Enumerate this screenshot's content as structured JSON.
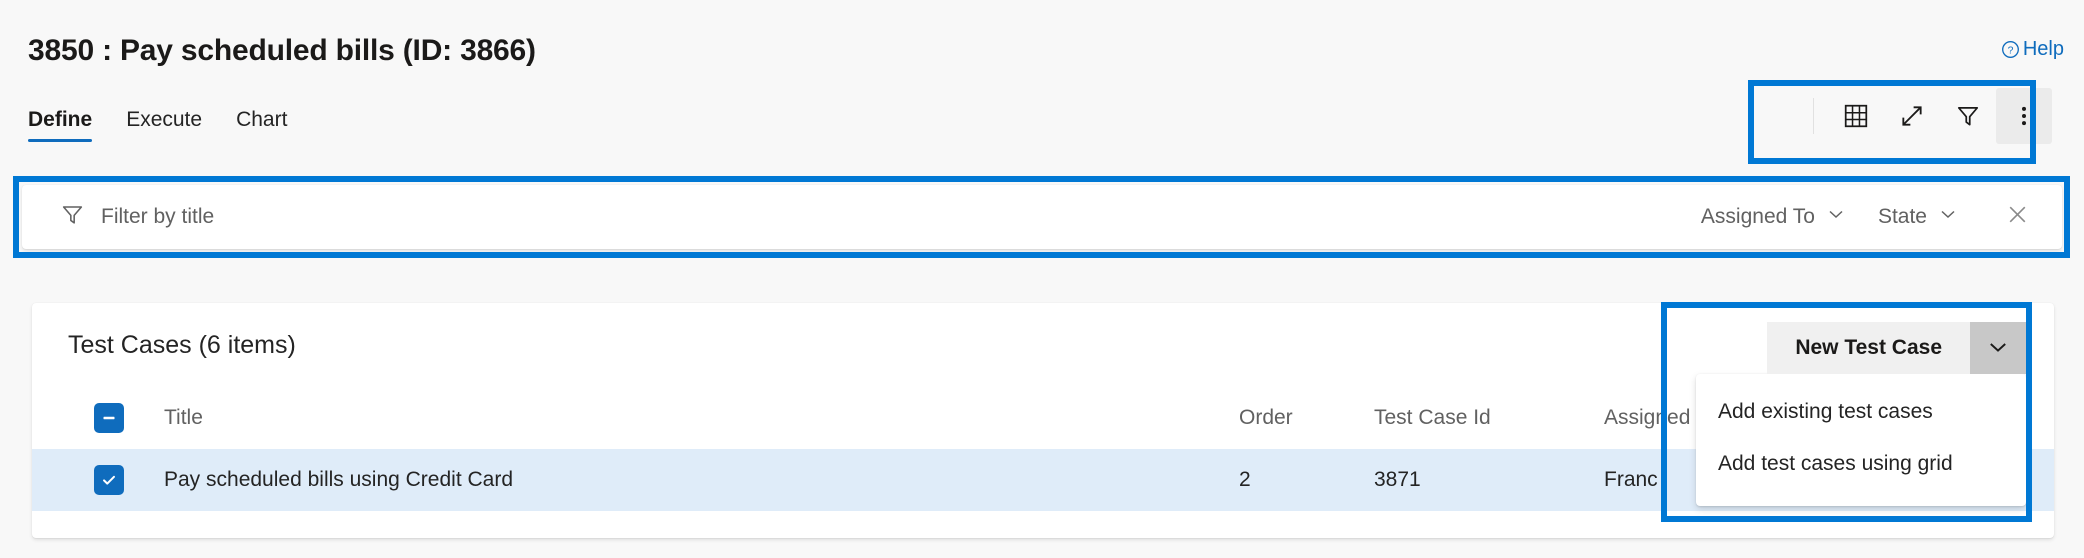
{
  "header": {
    "title": "3850 : Pay scheduled bills (ID: 3866)",
    "help_label": "Help",
    "help_icon": "question-circle-icon"
  },
  "tabs": [
    {
      "label": "Define",
      "active": true
    },
    {
      "label": "Execute",
      "active": false
    },
    {
      "label": "Chart",
      "active": false
    }
  ],
  "toolbar": {
    "buttons": [
      {
        "name": "grid-view-icon",
        "title": "Grid view"
      },
      {
        "name": "expand-icon",
        "title": "Enter full screen"
      },
      {
        "name": "filter-icon",
        "title": "Filter"
      },
      {
        "name": "more-options-icon",
        "title": "More options"
      }
    ]
  },
  "filter_bar": {
    "icon": "filter-funnel-icon",
    "placeholder": "Filter by title",
    "value": "",
    "assigned_to_label": "Assigned To",
    "state_label": "State",
    "close_icon": "close-icon"
  },
  "content": {
    "card_title": "Test Cases (6 items)",
    "new_test_case_label": "New Test Case",
    "dropdown_items": [
      "Add existing test cases",
      "Add test cases using grid"
    ],
    "columns": {
      "title": "Title",
      "order": "Order",
      "test_case_id": "Test Case Id",
      "assigned_to": "Assigned"
    },
    "rows": [
      {
        "selected": true,
        "title": "Pay scheduled bills using Credit Card",
        "order": "2",
        "test_case_id": "3871",
        "assigned_to": "Franc"
      }
    ]
  },
  "colors": {
    "accent": "#0f6cbd",
    "annotation": "#0078d4",
    "selected_row": "#dfecf9",
    "page_bg": "#f8f8f8"
  }
}
